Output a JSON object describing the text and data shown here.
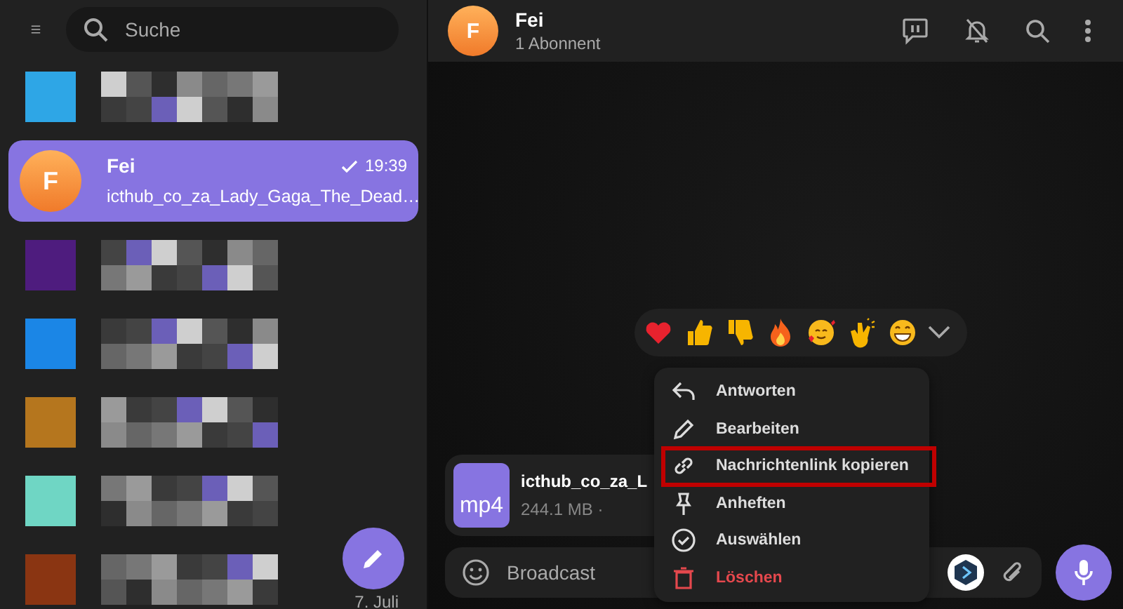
{
  "sidebar": {
    "search": {
      "placeholder": "Suche"
    },
    "chats": [
      {
        "kind": "redacted",
        "selected": false,
        "color": "#2ea6e6"
      },
      {
        "kind": "chat",
        "selected": true,
        "avatar": "F",
        "name": "Fei",
        "time": "19:39",
        "read": true,
        "preview": "icthub_co_za_Lady_Gaga_The_Dead…"
      },
      {
        "kind": "redacted",
        "selected": false,
        "color": "#4e1c7e"
      },
      {
        "kind": "redacted",
        "selected": false,
        "color": "#1b86e6"
      },
      {
        "kind": "redacted",
        "selected": false,
        "color": "#b5761e"
      },
      {
        "kind": "redacted",
        "selected": false,
        "color": "#6fd6c4"
      },
      {
        "kind": "redacted",
        "selected": false,
        "color": "#8a3512",
        "date": "7. Juli"
      }
    ]
  },
  "chat": {
    "avatar": "F",
    "title": "Fei",
    "subtitle": "1 Abonnent",
    "message": {
      "file_type": "mp4",
      "file_name": "icthub_co_za_L",
      "size": "244.1 MB ·"
    },
    "composer": {
      "placeholder": "Broadcast"
    }
  },
  "reactions": [
    {
      "kind": "heart"
    },
    {
      "kind": "thumbs-up"
    },
    {
      "kind": "thumbs-down"
    },
    {
      "kind": "fire"
    },
    {
      "kind": "smiling-hearts"
    },
    {
      "kind": "clapping"
    },
    {
      "kind": "grin"
    }
  ],
  "context_menu": [
    {
      "kind": "reply",
      "label": "Antworten",
      "highlighted": false,
      "danger": false
    },
    {
      "kind": "edit",
      "label": "Bearbeiten",
      "highlighted": false,
      "danger": false
    },
    {
      "kind": "link",
      "label": "Nachrichtenlink kopieren",
      "highlighted": true,
      "danger": false
    },
    {
      "kind": "pin",
      "label": "Anheften",
      "highlighted": false,
      "danger": false
    },
    {
      "kind": "select",
      "label": "Auswählen",
      "highlighted": false,
      "danger": false
    },
    {
      "kind": "delete",
      "label": "Löschen",
      "highlighted": false,
      "danger": true
    }
  ]
}
